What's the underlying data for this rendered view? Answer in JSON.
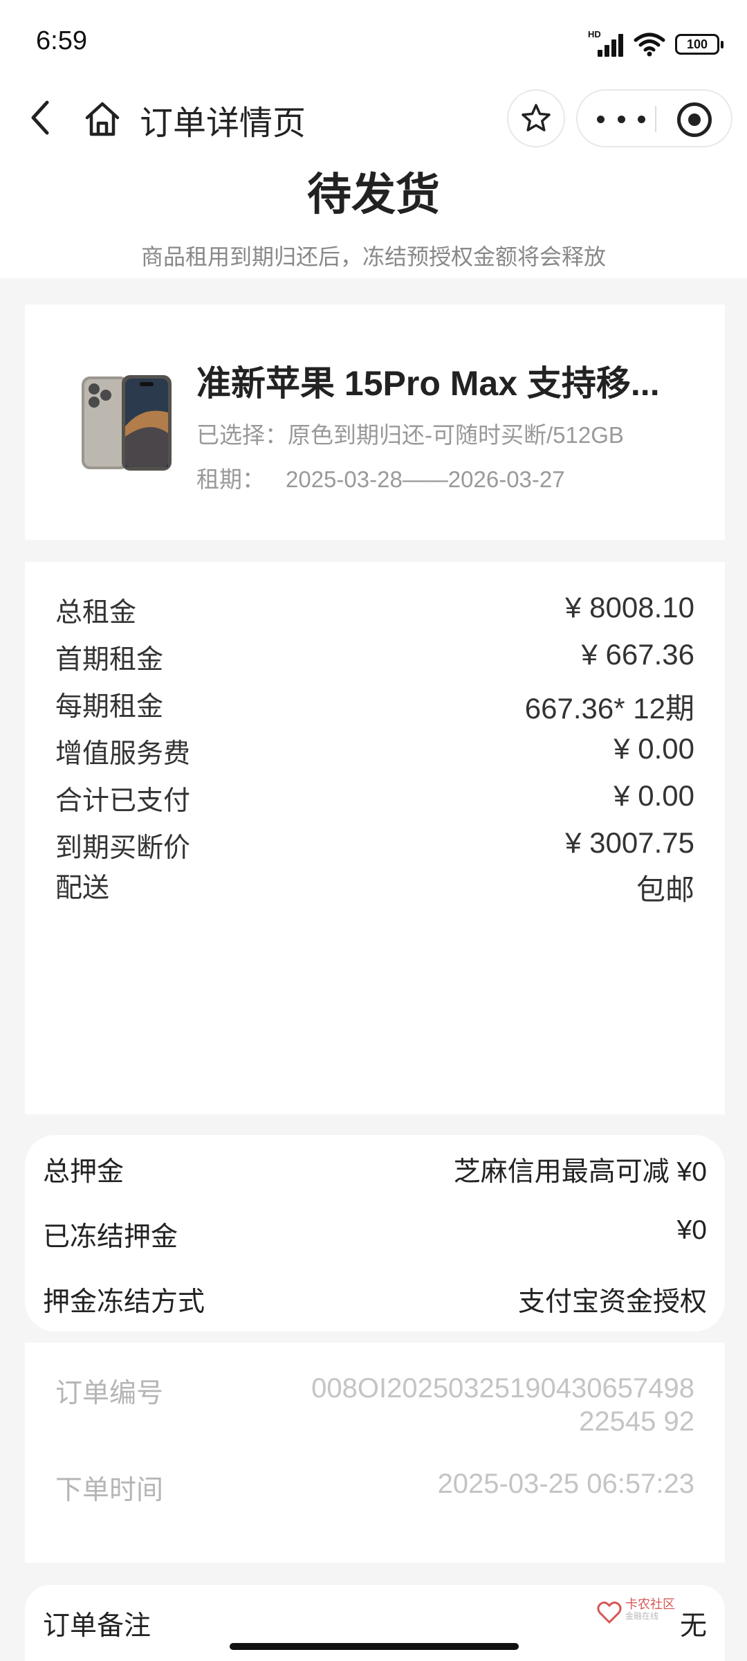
{
  "status_bar": {
    "time": "6:59",
    "network": "HD",
    "battery": "100"
  },
  "nav": {
    "title": "订单详情页",
    "icons": [
      "back-arrow-icon",
      "home-icon",
      "star-icon",
      "more-icon",
      "close-target-icon"
    ]
  },
  "order": {
    "status": "待发货",
    "hint": "商品租用到期归还后，冻结预授权金额将会释放"
  },
  "product": {
    "name": "准新苹果 15Pro Max 支持移...",
    "spec": "已选择：原色到期归还-可随时买断/512GB",
    "period_label": "租期：",
    "period_value": "2025-03-28——2026-03-27"
  },
  "rent": {
    "rows": [
      {
        "label": "总租金",
        "value": "¥ 8008.10"
      },
      {
        "label": "首期租金",
        "value": "¥ 667.36"
      },
      {
        "label": "每期租金",
        "value": "667.36* 12期"
      },
      {
        "label": "增值服务费",
        "value": "¥ 0.00"
      },
      {
        "label": "合计已支付",
        "value": "¥ 0.00"
      },
      {
        "label": "到期买断价",
        "value": "¥ 3007.75"
      },
      {
        "label": "配送",
        "value": "包邮"
      }
    ]
  },
  "deposit": {
    "rows": [
      {
        "label": "总押金",
        "value": "芝麻信用最高可减 ¥0"
      },
      {
        "label": "已冻结押金",
        "value": "¥0"
      },
      {
        "label": "押金冻结方式",
        "value": "支付宝资金授权"
      }
    ]
  },
  "info": {
    "order_no_label": "订单编号",
    "order_no_value": "008OI2025032519043065749822545 92",
    "order_time_label": "下单时间",
    "order_time_value": "2025-03-25 06:57:23"
  },
  "remark": {
    "label": "订单备注",
    "value": "无"
  },
  "watermark": {
    "text": "卡农社区",
    "sub": "金融在线"
  },
  "colors": {
    "background": "#f5f5f5",
    "card": "#ffffff",
    "text": "#222222",
    "muted": "#999999",
    "faint": "#c4c4c4"
  }
}
